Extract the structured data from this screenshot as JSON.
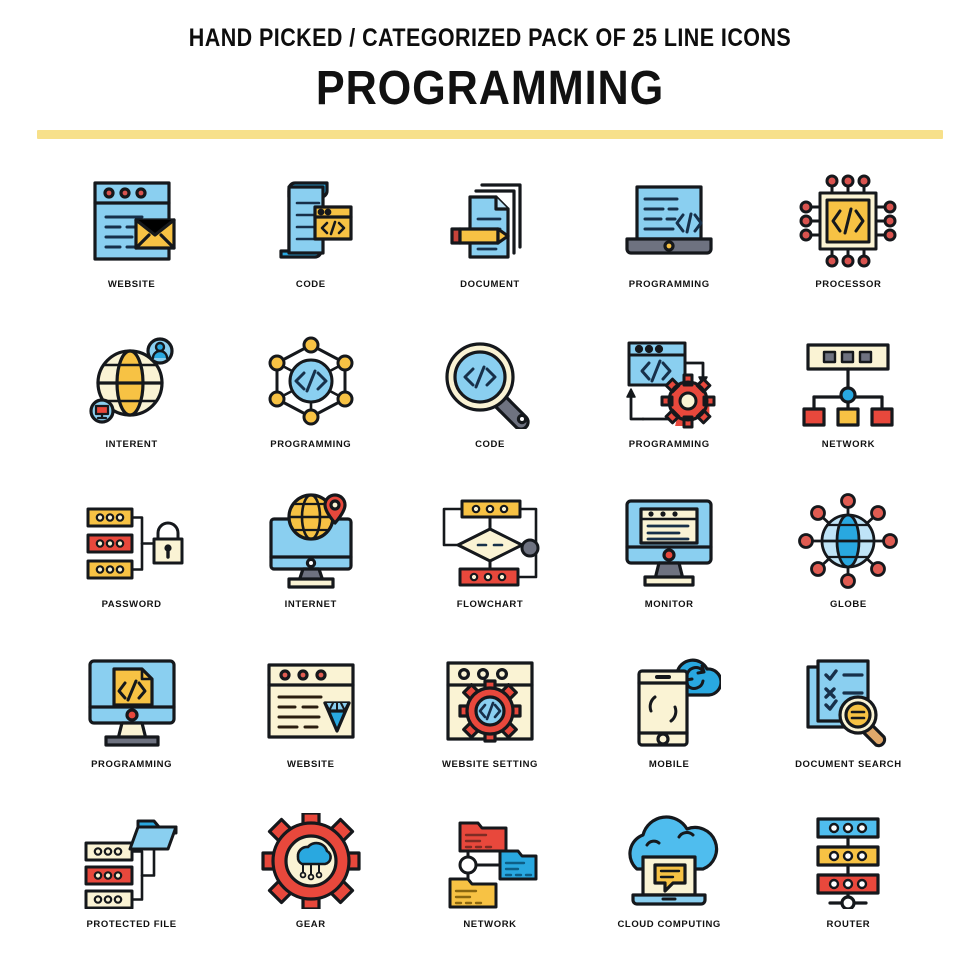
{
  "header": {
    "subtitle_pre": "HAND PICKED / CATEGORIZED PACK OF ",
    "subtitle_count": "25",
    "subtitle_post": " LINE ICONS",
    "title": "PROGRAMMING"
  },
  "palette": {
    "blue": "#8ACFF0",
    "blue_deep": "#29A8E0",
    "blue_dark": "#1E9BDC",
    "yellow": "#F7C244",
    "cream": "#FAF3D4",
    "red": "#E8483C",
    "red_dot": "#D9534F",
    "gray": "#6E7280",
    "outline": "#15181C",
    "rule": "#F7E08A"
  },
  "icons": [
    {
      "label": "WEBSITE",
      "name": "website-browser-mail-icon"
    },
    {
      "label": "CODE",
      "name": "code-document-icon"
    },
    {
      "label": "DOCUMENT",
      "name": "document-pencil-icon"
    },
    {
      "label": "PROGRAMMING",
      "name": "laptop-code-icon"
    },
    {
      "label": "PROCESSOR",
      "name": "processor-chip-icon"
    },
    {
      "label": "INTERENT",
      "name": "internet-globe-user-icon"
    },
    {
      "label": "PROGRAMMING",
      "name": "network-nodes-code-icon"
    },
    {
      "label": "CODE",
      "name": "magnifier-code-icon"
    },
    {
      "label": "PROGRAMMING",
      "name": "browser-gear-cycle-icon"
    },
    {
      "label": "NETWORK",
      "name": "network-tree-icon"
    },
    {
      "label": "PASSWORD",
      "name": "server-lock-icon"
    },
    {
      "label": "INTERNET",
      "name": "monitor-globe-pin-icon"
    },
    {
      "label": "FLOWCHART",
      "name": "flowchart-icon"
    },
    {
      "label": "MONITOR",
      "name": "monitor-window-icon"
    },
    {
      "label": "GLOBE",
      "name": "globe-nodes-icon"
    },
    {
      "label": "PROGRAMMING",
      "name": "monitor-code-file-icon"
    },
    {
      "label": "WEBSITE",
      "name": "browser-diamond-icon"
    },
    {
      "label": "WEBSITE SETTING",
      "name": "browser-gear-code-icon"
    },
    {
      "label": "MOBILE",
      "name": "mobile-cloud-sync-icon"
    },
    {
      "label": "DOCUMENT SEARCH",
      "name": "document-checklist-search-icon"
    },
    {
      "label": "PROTECTED FILE",
      "name": "server-folder-icon"
    },
    {
      "label": "GEAR",
      "name": "gear-cloud-icon"
    },
    {
      "label": "NETWORK",
      "name": "folder-network-icon"
    },
    {
      "label": "CLOUD COMPUTING",
      "name": "cloud-laptop-chat-icon"
    },
    {
      "label": "ROUTER",
      "name": "router-stack-icon"
    }
  ]
}
